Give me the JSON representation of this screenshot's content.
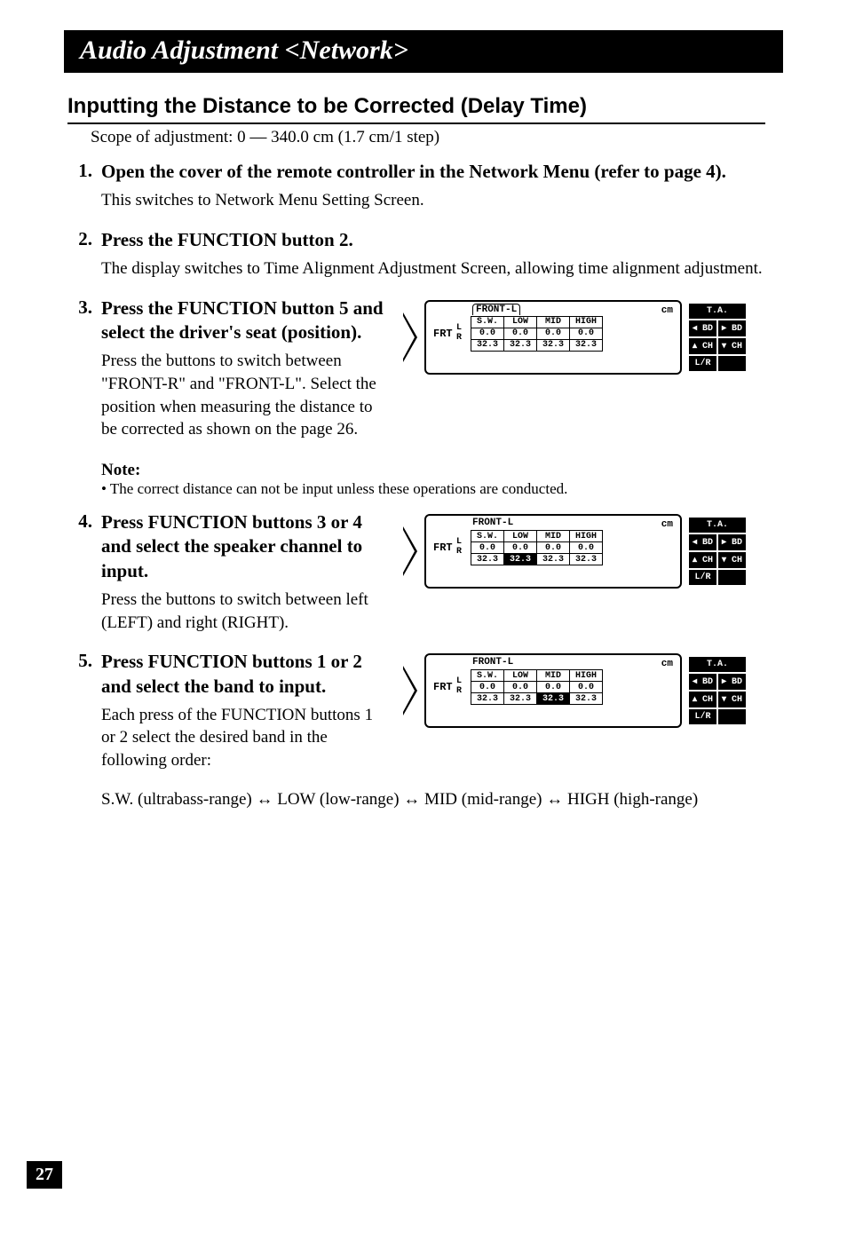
{
  "titleBar": "Audio Adjustment <Network>",
  "sectionHeading": "Inputting the Distance to be Corrected (Delay Time)",
  "scopeLine": "Scope of adjustment: 0 — 340.0 cm (1.7 cm/1 step)",
  "steps": {
    "s1": {
      "num": "1.",
      "title": "Open the cover of the remote controller in the Network Menu (refer to page 4).",
      "desc": "This switches to Network Menu Setting Screen."
    },
    "s2": {
      "num": "2.",
      "title": "Press the FUNCTION button 2.",
      "desc": "The display switches to Time Alignment Adjustment Screen, allowing time alignment adjustment."
    },
    "s3": {
      "num": "3.",
      "title": "Press the FUNCTION button 5 and select the driver's seat (position).",
      "desc": "Press the buttons to switch between \"FRONT-R\" and \"FRONT-L\". Select the position when measuring the distance to be corrected as shown on the page 26."
    },
    "s4": {
      "num": "4.",
      "title": "Press FUNCTION buttons 3 or 4 and select the speaker channel to input.",
      "desc": "Press the buttons to switch between left (LEFT) and right (RIGHT)."
    },
    "s5": {
      "num": "5.",
      "title": "Press FUNCTION buttons 1 or 2 and select the band to input.",
      "desc": "Each press of the FUNCTION buttons 1 or 2 select the desired band in the following order:"
    }
  },
  "note": {
    "label": "Note:",
    "bullet": "• The correct distance can not be input unless these operations are conducted."
  },
  "bandFlow": "S.W. (ultrabass-range) ↔ LOW (low-range) ↔ MID (mid-range) ↔ HIGH (high-range)",
  "display": {
    "front": "FRONT-L",
    "cm": "cm",
    "frt": "FRT",
    "l": "L",
    "r": "R",
    "headers": {
      "sw": "S.W.",
      "low": "LOW",
      "mid": "MID",
      "high": "HIGH"
    },
    "screen3": {
      "rowL": {
        "sw": "0.0",
        "low": "0.0",
        "mid": "0.0",
        "high": "0.0"
      },
      "rowR": {
        "sw": "32.3",
        "low": "32.3",
        "mid": "32.3",
        "high": "32.3"
      },
      "frontBracket": true
    },
    "screen4": {
      "rowL": {
        "sw": "0.0",
        "low": "0.0",
        "mid": "0.0",
        "high": "0.0"
      },
      "rowR": {
        "sw": "32.3",
        "low": "32.3",
        "mid": "32.3",
        "high": "32.3"
      },
      "highlight": "rowR.low"
    },
    "screen5": {
      "rowL": {
        "sw": "0.0",
        "low": "0.0",
        "mid": "0.0",
        "high": "0.0"
      },
      "rowR": {
        "sw": "32.3",
        "low": "32.3",
        "mid": "32.3",
        "high": "32.3"
      },
      "highlight": "rowR.mid"
    },
    "side": {
      "ta": "T.A.",
      "bdL": "◂ BD",
      "bdR": "▸ BD",
      "chU": "▴ CH",
      "chD": "▾ CH",
      "lr": "L/R",
      "blank": ""
    }
  },
  "pageNumber": "27"
}
